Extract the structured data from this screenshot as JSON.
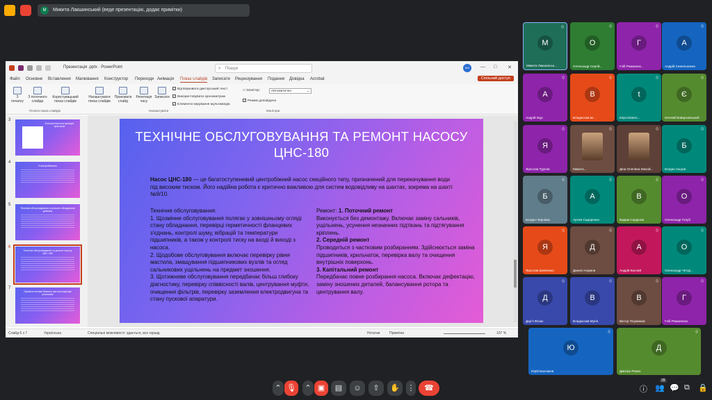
{
  "meet": {
    "presenter_banner": "Микита Лакшинський (веде презентацію, додає примітки)",
    "presenter_initial": "M",
    "participant_count": "28"
  },
  "powerpoint": {
    "file_name": "Презентація .pptx",
    "app_name": "PowerPoint",
    "search_placeholder": "Пошук",
    "user_initials": "МЛ",
    "share_label": "Спільний доступ",
    "menu": [
      "Файл",
      "Основне",
      "Вставлення",
      "Малювання",
      "Конструктор",
      "Переходи",
      "Анімація",
      "Показ слайдів",
      "Записати",
      "Рецензування",
      "Подання",
      "Довідка",
      "Acrobat"
    ],
    "active_menu": "Показ слайдів",
    "ribbon": {
      "from_start": "З початку",
      "from_current": "З поточного слайда",
      "custom_show": "Користувацький показ слайдів",
      "setup_show": "Налаштувати показ слайдів",
      "hide_slide": "Приховати слайд",
      "rehearse": "Репетиція часу",
      "record": "Записати",
      "play_narrations": "Відтворювати дикторський текст",
      "use_timings": "Використовувати хронометраж",
      "show_media_controls": "Елементи керування мультимедіа",
      "monitor_label": "Монітор:",
      "monitor_value": "Автоматично",
      "presenter_view": "Режим доповідача",
      "group_start": "Почати показ слайдів",
      "group_setup": "Налаштувати",
      "group_monitors": "Монітори"
    },
    "thumbnails": [
      {
        "num": "3",
        "title": "Електротехнічна принцип пристрою"
      },
      {
        "num": "4",
        "title": "Електробезпека"
      },
      {
        "num": "5",
        "title": "Технічне обслуговування та ремонт обладнання дільниці"
      },
      {
        "num": "6",
        "title": "Технічне обслуговування та ремонт насосу ЦНС-180"
      },
      {
        "num": "7",
        "title": "Правила техніки безпеки при експлуатації установки"
      }
    ],
    "slide": {
      "title": "Технічне обслуговування та ремонт насосу ЦНС-180",
      "intro_bold": "Насос ЦНС-180",
      "intro_rest": " — це багатоступеневий центробіжний насос секційного типу, призначений для перекачування води під високим тиском. Його надійна робота є критично важливою для систем водовідливу на шахтах, зокрема на шахті №9/10.",
      "left_heading": "Технічне обслуговування:",
      "left_items": [
        "1. Щозмінне обслуговування полягає у зовнішньому огляді стану обладнання, перевірці герметичності фланцевих з'єднань, контролі шуму, вібрацій та температури підшипників, а також у контролі тиску на вході й виході з насоса.",
        "2. Щодобове обслуговування включає перевірку рівня мастила, змащування підшипникових вузлів та огляд сальникових ущільнень на предмет зношення.",
        "3. Щотижневе обслуговування передбачає більш глибоку діагностику, перевірку співвісності валів, центрування муфти, очищення фільтрів, перевірку заземлення електродвигуна та стану пускової апаратури."
      ],
      "right_label": "Ремонт: ",
      "r1_title": "1. Поточний ремонт",
      "r1_text": "Виконується без демонтажу. Включає заміну сальників, ущільнень, усунення незначних підтікань та підтягування кріплень.",
      "r2_title": "2. Середній ремонт",
      "r2_text": "Проводиться з частковим розбиранням. Здійснюється заміна підшипників, крильчаток, перевірка валу та очищення внутрішніх поверхонь.",
      "r3_title": "3. Капітальний ремонт",
      "r3_text": "Передбачає повне розбирання насоса. Включає дефектацію, заміну зношених деталей, балансування ротора та центрування валу."
    },
    "status": {
      "slide_count": "Слайд 6 з 7",
      "language": "Українська",
      "accessibility": "Спеціальні можливості: здається, все гаразд",
      "notes": "Нотатки",
      "comments": "Примітки",
      "zoom": "107 %"
    }
  },
  "participants": [
    {
      "initial": "М",
      "name": "Микита Лакшинськ...",
      "color": "#1e6e58"
    },
    {
      "initial": "О",
      "name": "Олександр Сергій...",
      "color": "#2e7d32"
    },
    {
      "initial": "Г",
      "name": "Гліб Романенк...",
      "color": "#8e24aa"
    },
    {
      "initial": "А",
      "name": "Андрій Синельников",
      "color": "#1565c0"
    },
    {
      "initial": "А",
      "name": "Андрій Жур",
      "color": "#8e24aa"
    },
    {
      "initial": "В",
      "name": "Владислав Ш...",
      "color": "#e64a19"
    },
    {
      "initial": "t",
      "name": "tetya tetaren...",
      "color": "#00897b"
    },
    {
      "initial": "Є",
      "name": "Євгеній Войцеховський",
      "color": "#558b2f"
    },
    {
      "initial": "Я",
      "name": "Ярослав Турлов",
      "color": "#8e24aa"
    },
    {
      "initial": "",
      "name": "Микита...",
      "color": "#6d4c41"
    },
    {
      "initial": "",
      "name": "Діна Олегівна Михай...",
      "color": "#5d4037"
    },
    {
      "initial": "Б",
      "name": "Богдан Ільцов",
      "color": "#00897b"
    },
    {
      "initial": "Б",
      "name": "Богдан Черніков",
      "color": "#607d8b"
    },
    {
      "initial": "А",
      "name": "Артем Сидоренко",
      "color": "#00897b"
    },
    {
      "initial": "В",
      "name": "Вадим Сердюкін",
      "color": "#558b2f"
    },
    {
      "initial": "О",
      "name": "Олександр Голуб",
      "color": "#8e24aa"
    },
    {
      "initial": "Я",
      "name": "Ярослав Шевченко",
      "color": "#e64a19"
    },
    {
      "initial": "Д",
      "name": "Даниїл Наумов",
      "color": "#6d4c41"
    },
    {
      "initial": "А",
      "name": "Андрій Кислий",
      "color": "#c2185b"
    },
    {
      "initial": "О",
      "name": "Олександр Четур...",
      "color": "#00897b"
    },
    {
      "initial": "Д",
      "name": "Дарʼя Фісюк",
      "color": "#3949ab"
    },
    {
      "initial": "В",
      "name": "Владислав Мугін",
      "color": "#3949ab"
    },
    {
      "initial": "В",
      "name": "Віктор Плужніков",
      "color": "#6d4c41"
    },
    {
      "initial": "Г",
      "name": "Гліб Романенко",
      "color": "#8e24aa"
    },
    {
      "initial": "Ю",
      "name": "Юрій Бахлаков",
      "color": "#1565c0"
    },
    {
      "initial": "Д",
      "name": "Дмитро Ряжко",
      "color": "#558b2f"
    }
  ]
}
